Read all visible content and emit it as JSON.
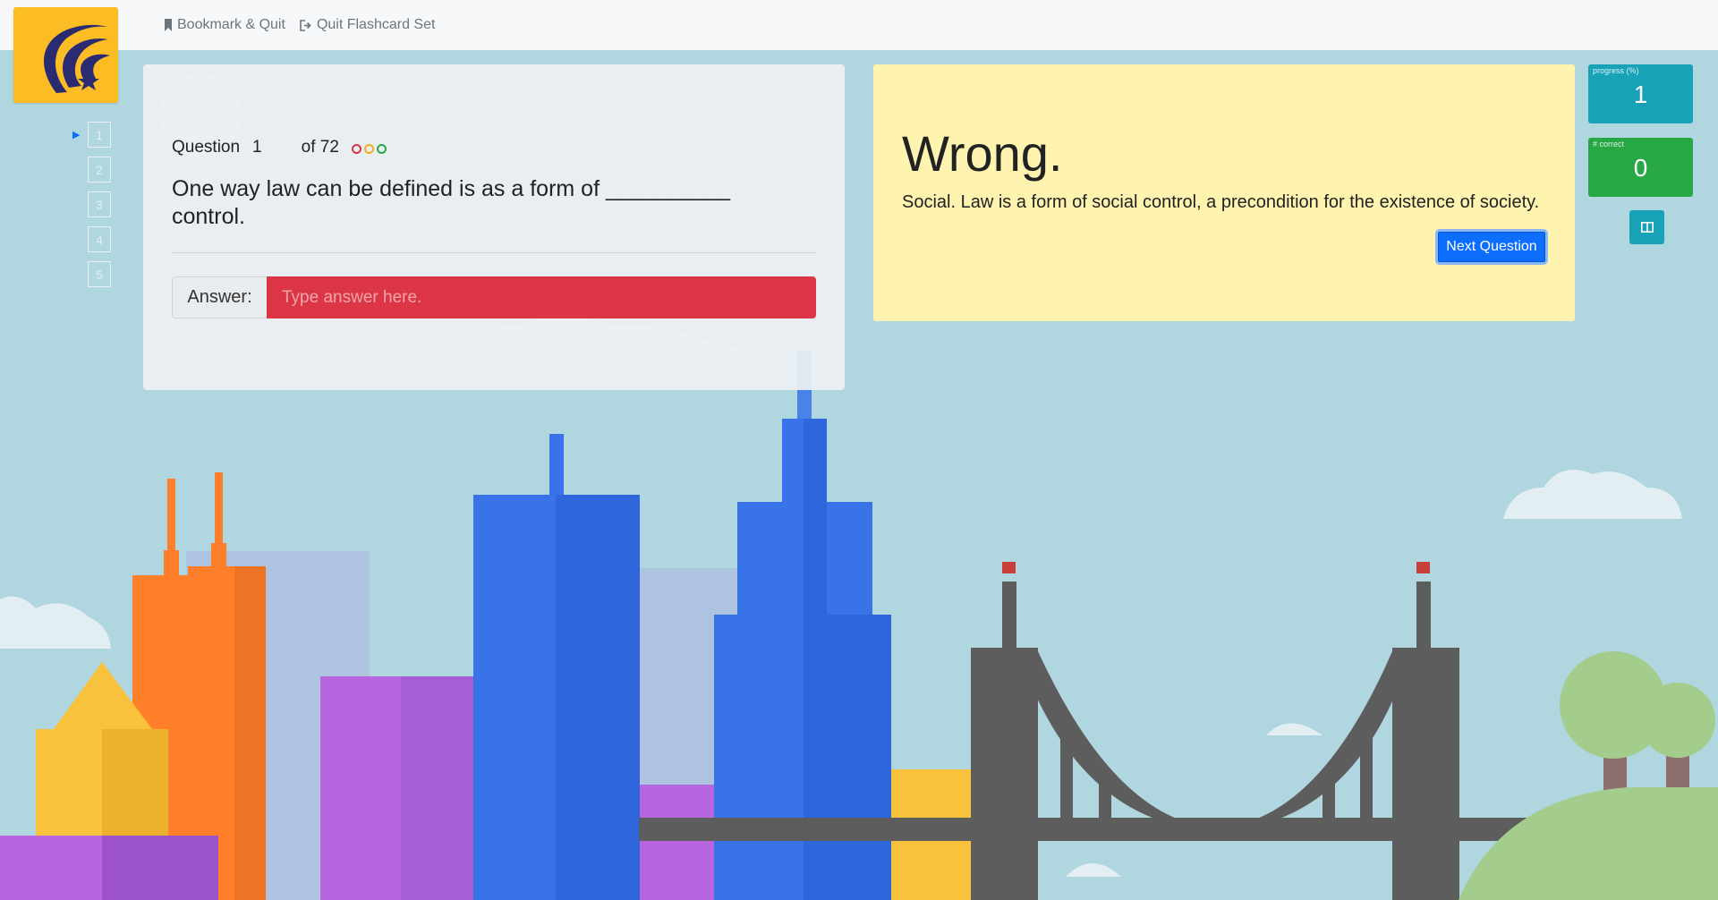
{
  "nav": {
    "bookmark_label": "Bookmark & Quit",
    "quit_label": "Quit Flashcard Set"
  },
  "question_index": [
    "1",
    "2",
    "3",
    "4",
    "5"
  ],
  "question": {
    "label": "Question",
    "number": "1",
    "of_label": "of 72",
    "text": "One way law can be defined is as a form of __________ control.",
    "status_dot_colors": [
      "#dc3545",
      "#f0ad1a",
      "#28a745"
    ]
  },
  "answer": {
    "label": "Answer:",
    "placeholder": "Type answer here."
  },
  "feedback": {
    "title": "Wrong.",
    "explanation": "Social. Law is a form of social control, a precondition for the existence of society.",
    "next_label": "Next Question"
  },
  "stats": {
    "progress_label": "progress (%)",
    "progress_value": "1",
    "correct_label": "# correct",
    "correct_value": "0"
  },
  "colors": {
    "background": "#b0d6e0",
    "logo": "#fbbd23",
    "danger": "#dc3545",
    "primary": "#0d6efd",
    "info": "#17a2b8",
    "success": "#28a745",
    "feedback_bg": "#fff3b0"
  },
  "icons": [
    "logo-icon",
    "bookmark-icon",
    "sign-out-icon",
    "current-question-arrow-icon",
    "split-layout-icon"
  ]
}
